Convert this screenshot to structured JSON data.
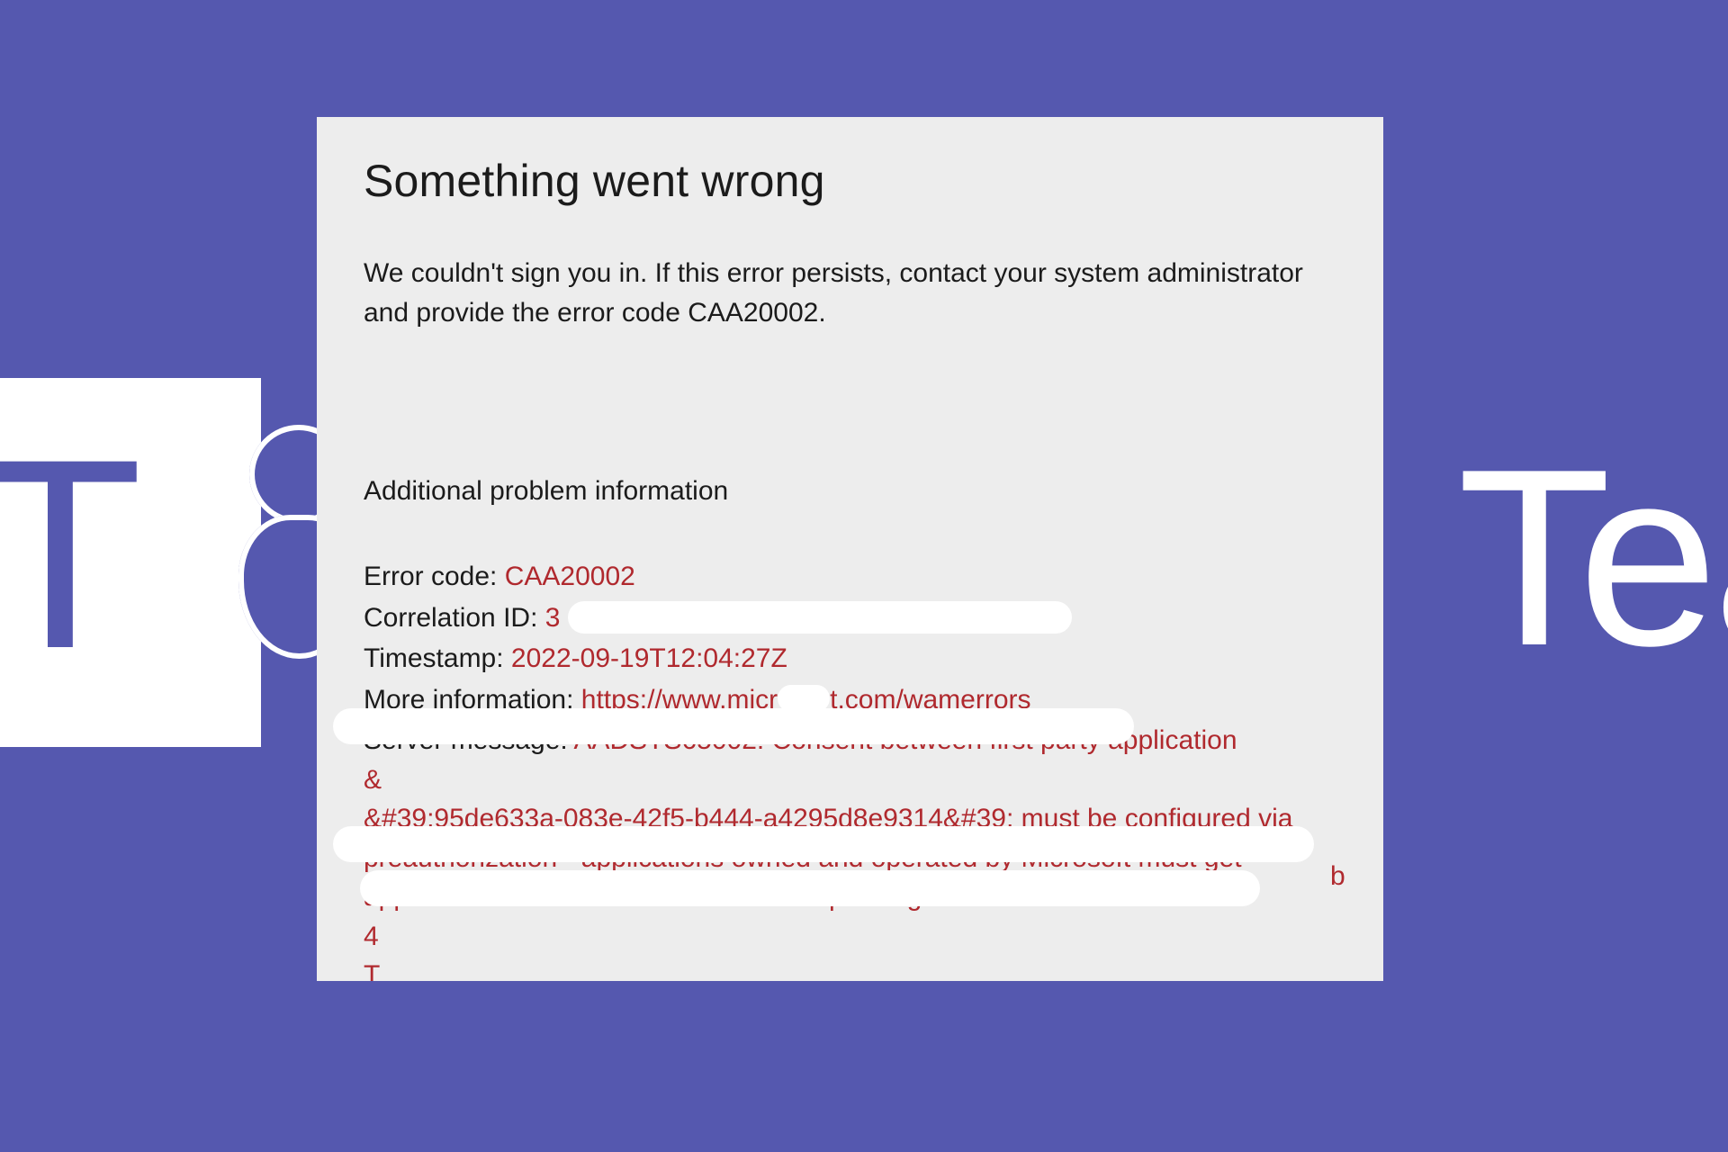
{
  "brand": {
    "tile_letter": "T",
    "wordmark": "Tear"
  },
  "dialog": {
    "title": "Something went wrong",
    "message": "We couldn't sign you in. If this error persists, contact your system administrator and provide the error code CAA20002.",
    "additional_heading": "Additional problem information",
    "details": {
      "error_code_label": "Error code: ",
      "error_code_value": "CAA20002",
      "correlation_label": "Correlation ID: ",
      "correlation_value_visible": "3",
      "timestamp_label": "Timestamp: ",
      "timestamp_value": "2022-09-19T12:04:27Z",
      "more_info_label": "More information: ",
      "more_info_value_pre": "https://www.micr",
      "more_info_value_post": "t.com/wamerrors",
      "server_label": "Server message: ",
      "server_value_line1": "AADSTS65002: Consent between first party application",
      "server_value_line2": "&#39;95de633a-083e-42f5-b444-a4295d8e9314&#39; must be configured via preauthorization - applications owned and operated by Microsoft must get approval from the API owner before requesting tokens for that API. T",
      "trailing_fragments": {
        "four": "4",
        "b": "b",
        "T": "T"
      }
    }
  },
  "colors": {
    "brand_purple": "#5558af",
    "error_red": "#b0292e",
    "dialog_bg": "#ededed"
  }
}
